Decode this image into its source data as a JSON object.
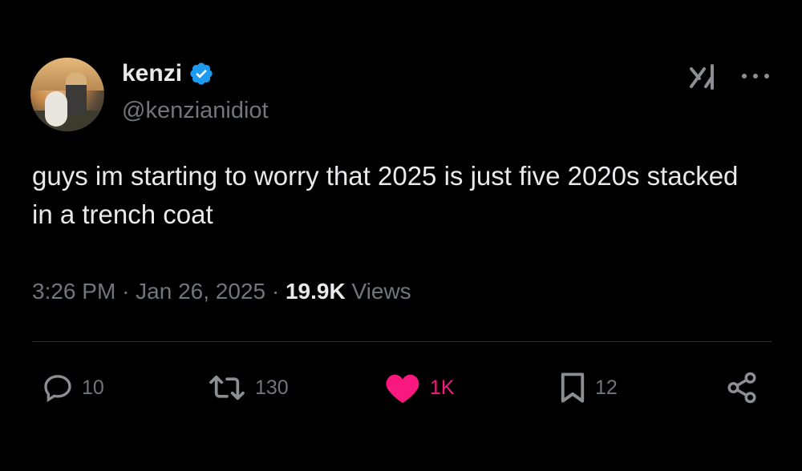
{
  "author": {
    "display_name": "kenzi",
    "handle": "@kenzianidiot",
    "verified": true,
    "verified_color": "#1d9bf0"
  },
  "tweet": {
    "text": "guys im starting to worry that 2025 is just five 2020s stacked in a trench coat",
    "time": "3:26 PM",
    "date": "Jan 26, 2025",
    "separator": "·",
    "views_count": "19.9K",
    "views_label": "Views"
  },
  "header_icons": [
    "grok-icon",
    "more-icon"
  ],
  "actions": {
    "reply": {
      "count": "10",
      "icon": "reply-icon"
    },
    "retweet": {
      "count": "130",
      "icon": "retweet-icon"
    },
    "like": {
      "count": "1K",
      "icon": "heart-icon",
      "liked": true,
      "color": "#f91880"
    },
    "bookmark": {
      "count": "12",
      "icon": "bookmark-icon"
    },
    "share": {
      "icon": "share-icon"
    }
  },
  "colors": {
    "background": "#000000",
    "text": "#e7e9ea",
    "secondary": "#71767b",
    "divider": "#2f3336"
  }
}
